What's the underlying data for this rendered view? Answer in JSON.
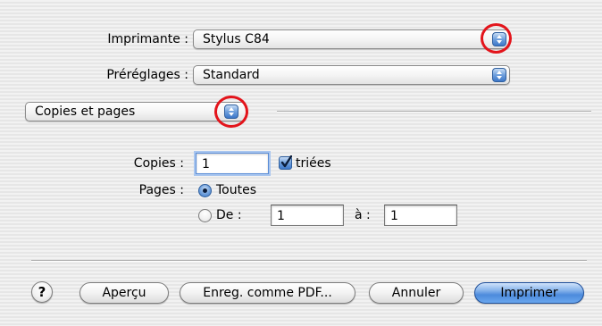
{
  "printer": {
    "label": "Imprimante :",
    "value": "Stylus C84"
  },
  "presets": {
    "label": "Préréglages :",
    "value": "Standard"
  },
  "panel": {
    "value": "Copies et pages"
  },
  "copies": {
    "label": "Copies :",
    "value": "1",
    "collated_label": "triées",
    "collated_checked": true
  },
  "pages": {
    "label": "Pages :",
    "all_label": "Toutes",
    "range_label": "De :",
    "range_from": "1",
    "range_to_label": "à :",
    "range_to": "1",
    "selected": "all"
  },
  "buttons": {
    "help": "?",
    "preview": "Aperçu",
    "save_pdf": "Enreg. comme PDF...",
    "cancel": "Annuler",
    "print": "Imprimer"
  },
  "colors": {
    "callout": "#e3141b",
    "aqua_blue": "#3d78c9"
  }
}
